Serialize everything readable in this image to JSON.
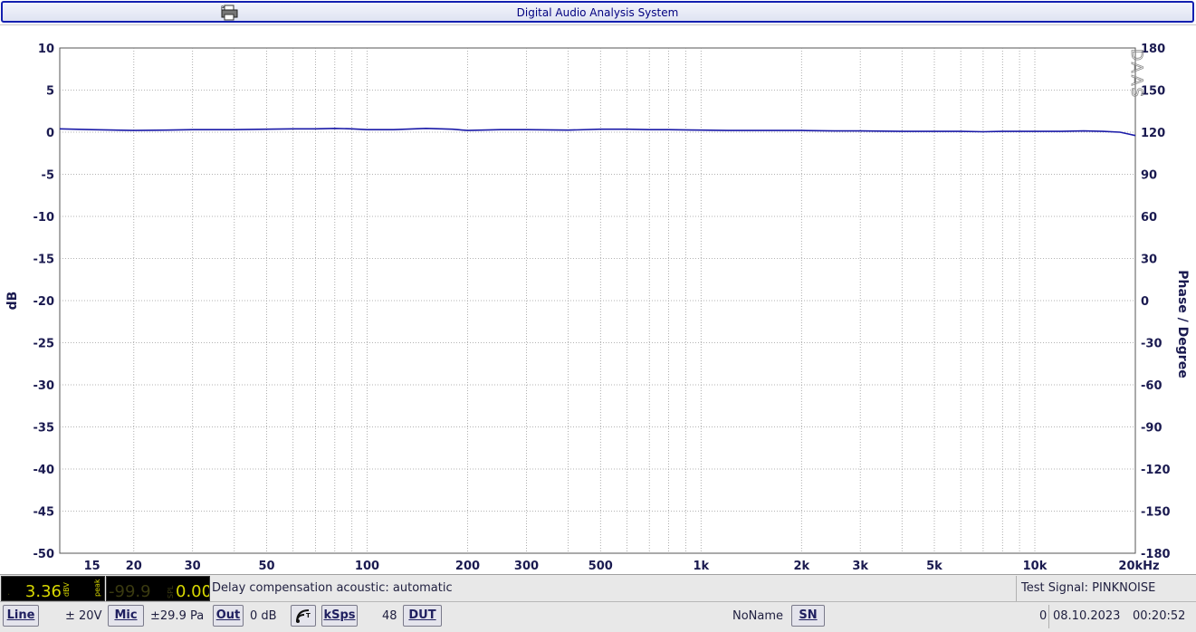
{
  "window": {
    "title": "Digital Audio Analysis System"
  },
  "icons": {
    "printer": "printer-icon",
    "signal": "signal-wave-icon"
  },
  "colors": {
    "trace": "#1a1aa8",
    "axis_text": "#1a1a50",
    "title_border": "#1420b0",
    "meter_yellow": "#d8d800",
    "meter_dim": "#3a3a10"
  },
  "chart_data": {
    "type": "line",
    "xscale": "log",
    "xlim": [
      12,
      20000
    ],
    "ylim": [
      -50,
      10
    ],
    "y2lim": [
      -180,
      180
    ],
    "ylabel": "dB",
    "y2label": "Phase / Degree",
    "watermark": "DAAS",
    "grid": true,
    "xticks": [
      {
        "v": 15,
        "label": "15"
      },
      {
        "v": 20,
        "label": "20"
      },
      {
        "v": 30,
        "label": "30"
      },
      {
        "v": 50,
        "label": "50"
      },
      {
        "v": 100,
        "label": "100"
      },
      {
        "v": 200,
        "label": "200"
      },
      {
        "v": 300,
        "label": "300"
      },
      {
        "v": 500,
        "label": "500"
      },
      {
        "v": 1000,
        "label": "1k"
      },
      {
        "v": 2000,
        "label": "2k"
      },
      {
        "v": 3000,
        "label": "3k"
      },
      {
        "v": 5000,
        "label": "5k"
      },
      {
        "v": 10000,
        "label": "10k"
      },
      {
        "v": 20000,
        "label": "20kHz"
      }
    ],
    "yticks": [
      "10",
      "5",
      "0",
      "-5",
      "-10",
      "-15",
      "-20",
      "-25",
      "-30",
      "-35",
      "-40",
      "-45",
      "-50"
    ],
    "y2ticks": [
      "180",
      "150",
      "120",
      "90",
      "60",
      "30",
      "0",
      "-30",
      "-60",
      "-90",
      "-120",
      "-150",
      "-180"
    ],
    "series": [
      {
        "x": [
          12,
          15,
          20,
          25,
          30,
          40,
          50,
          60,
          70,
          80,
          90,
          100,
          120,
          150,
          180,
          200,
          250,
          300,
          400,
          500,
          600,
          700,
          800,
          1000,
          1200,
          1500,
          2000,
          2500,
          3000,
          4000,
          5000,
          6000,
          7000,
          8000,
          9000,
          10000,
          12000,
          14000,
          16000,
          18000,
          19000,
          20000
        ],
        "y": [
          0.4,
          0.3,
          0.2,
          0.25,
          0.3,
          0.3,
          0.35,
          0.4,
          0.4,
          0.45,
          0.4,
          0.3,
          0.3,
          0.45,
          0.35,
          0.2,
          0.3,
          0.3,
          0.25,
          0.35,
          0.35,
          0.3,
          0.3,
          0.25,
          0.2,
          0.2,
          0.2,
          0.15,
          0.15,
          0.1,
          0.1,
          0.1,
          0.05,
          0.1,
          0.1,
          0.1,
          0.1,
          0.15,
          0.1,
          0.0,
          -0.2,
          -0.4
        ]
      }
    ]
  },
  "meters": {
    "dbv_value": "3.36",
    "dbv_unit": "dBV",
    "dbv_sub": "peak",
    "spl_value": "-99.9",
    "spl_unit": "SPL",
    "spl_right": "0.00"
  },
  "status": {
    "delay_text": "Delay compensation acoustic: automatic",
    "test_signal": "Test Signal: PINKNOISE"
  },
  "bottombar": {
    "line_label": "Line",
    "line_range": "± 20V",
    "mic_label": "Mic",
    "mic_range": "±29.9 Pa",
    "out_label": "Out",
    "out_level": "0 dB",
    "ksps_label": "kSps",
    "ksps_value": "48",
    "dut_label": "DUT",
    "device_name": "NoName",
    "sn_label": "SN",
    "counter": "0",
    "date": "08.10.2023",
    "time": "00:20:52"
  }
}
